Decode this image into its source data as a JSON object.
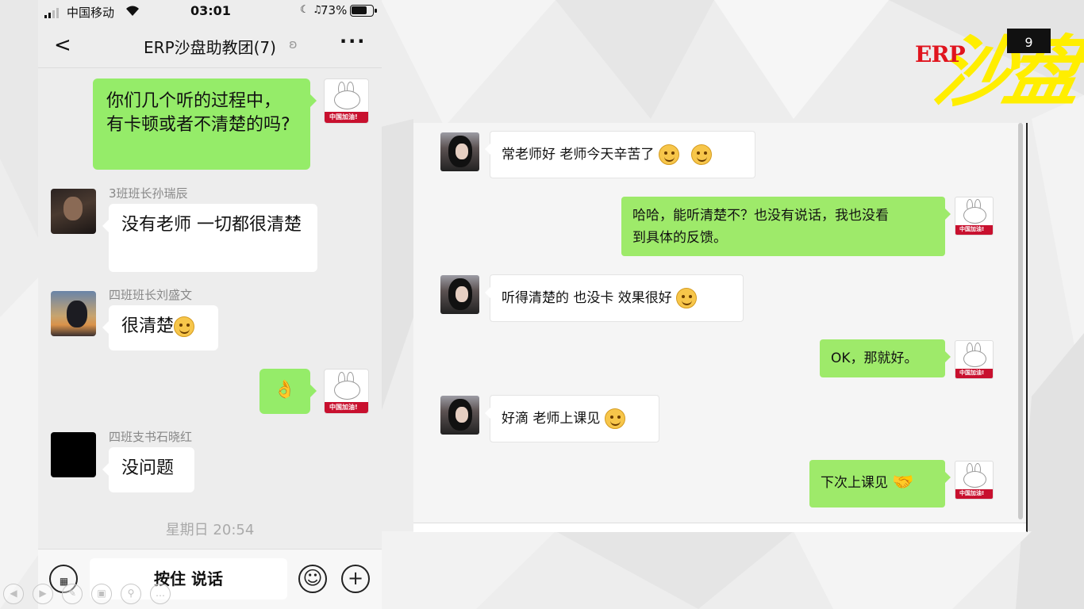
{
  "phone": {
    "status": {
      "carrier": "中国移动",
      "time": "03:01",
      "battery": "73%"
    },
    "nav": {
      "back": "<",
      "title": "ERP沙盘助教团(7)",
      "more": "···"
    },
    "messages": [
      {
        "side": "right",
        "text": "你们几个听的过程中，有卡顿或者不清楚的吗?"
      },
      {
        "side": "left",
        "sender": "3班班长孙瑞辰",
        "text": "没有老师 一切都很清楚"
      },
      {
        "side": "left",
        "sender": "四班班长刘盛文",
        "text": "很清楚"
      },
      {
        "side": "right",
        "text": "👌"
      },
      {
        "side": "left",
        "sender": "四班支书石晓红",
        "text": "没问题"
      }
    ],
    "avatar_band": "中国加油!",
    "timestamp": "星期日 20:54",
    "input": {
      "talk_label": "按住 说话",
      "emoji": "☺",
      "plus": "+"
    }
  },
  "chat": {
    "messages": [
      {
        "side": "left",
        "text": "常老师好 老师今天辛苦了"
      },
      {
        "side": "right",
        "line1": "哈哈，能听清楚不？也没有说话，我也没看",
        "line2": "到具体的反馈。"
      },
      {
        "side": "left",
        "text": "听得清楚的 也没卡 效果很好"
      },
      {
        "side": "right",
        "text": "OK，那就好。"
      },
      {
        "side": "left",
        "text": "好滴 老师上课见"
      },
      {
        "side": "right",
        "text": "下次上课见"
      }
    ],
    "avatar_band": "中国加油!"
  },
  "logo": {
    "erp": "ERP",
    "sha": "沙盘"
  },
  "page_number": "9",
  "slide_nav_icons": [
    "prev-icon",
    "next-icon",
    "pen-icon",
    "slides-icon",
    "zoom-icon",
    "more-icon"
  ]
}
